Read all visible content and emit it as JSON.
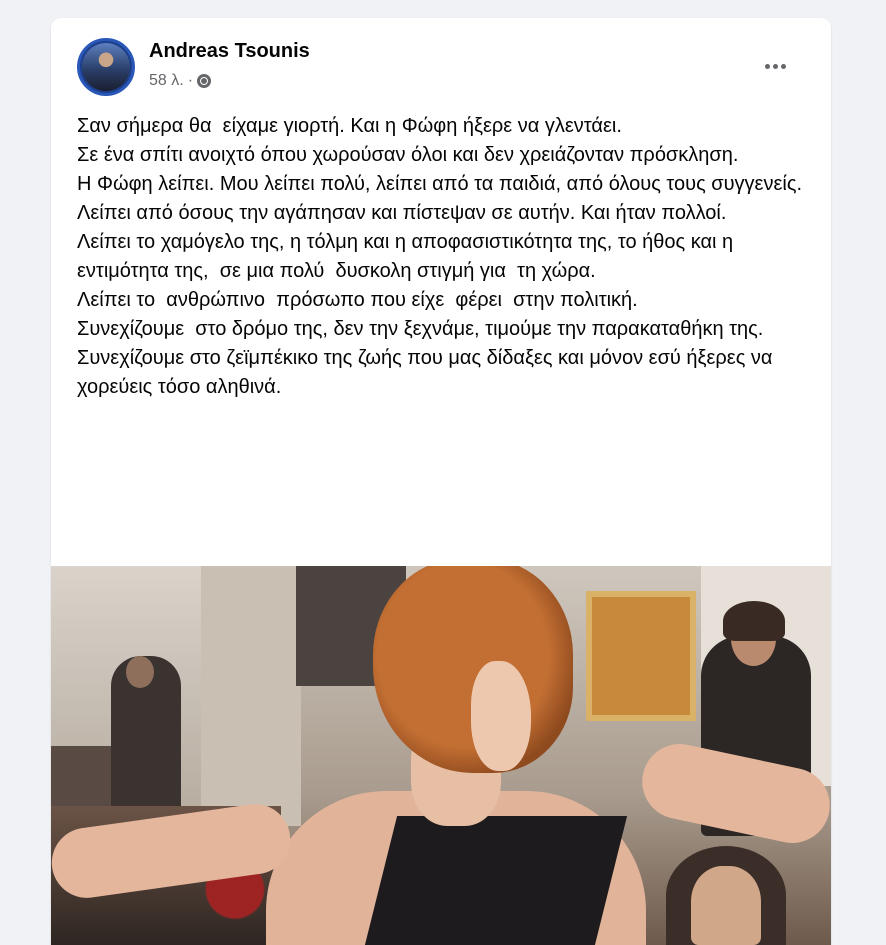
{
  "post": {
    "author": "Andreas Tsounis",
    "timestamp": "58 λ.",
    "separator": "·",
    "audience_icon": "globe-icon",
    "menu_icon": "more-options-icon",
    "paragraphs": [
      "Σαν σήμερα θα  είχαμε γιορτή. Και η Φώφη ήξερε να γλεντάει.",
      "Σε ένα σπίτι ανοιχτό όπου χωρούσαν όλοι και δεν χρειάζονταν πρόσκληση.",
      "Η Φώφη λείπει. Μου λείπει πολύ, λείπει από τα παιδιά, από όλους τους συγγενείς. Λείπει από όσους την αγάπησαν και πίστεψαν σε αυτήν. Και ήταν πολλοί.",
      "Λείπει το χαμόγελο της, η τόλμη και η αποφασιστικότητα της, το ήθος και η εντιμότητα της,  σε μια πολύ  δυσκολη στιγμή για  τη χώρα.",
      "Λείπει το  ανθρώπινο  πρόσωπο που είχε  φέρει  στην πολιτική.",
      "Συνεχίζουμε  στο δρόμο της, δεν την ξεχνάμε, τιμούμε την παρακαταθήκη της.",
      "Συνεχίζουμε στο ζεϊμπέκικο της ζωής που μας δίδαξες και μόνον εσύ ήξερες να χορεύεις τόσο αληθινά."
    ]
  },
  "colors": {
    "page_bg": "#f0f2f5",
    "card_bg": "#ffffff",
    "text": "#050505",
    "secondary_text": "#65676b"
  }
}
